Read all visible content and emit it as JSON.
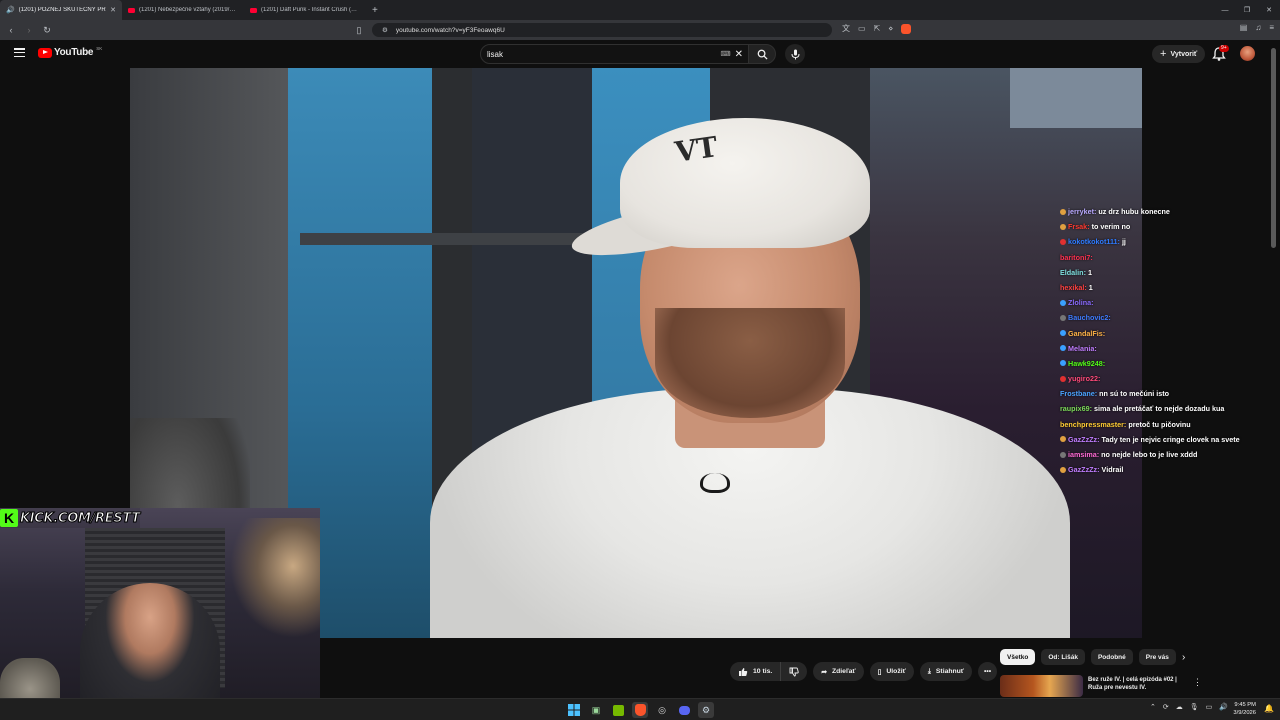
{
  "browser": {
    "tabs": [
      {
        "title": "(1201) POZNEJ SKUTEČNÝ PŘ",
        "active": true
      },
      {
        "title": "(1201) Nebezpečné vztahy (2019/2020",
        "active": false
      },
      {
        "title": "(1201) Daft Punk - Instant Crush (Offi",
        "active": false
      }
    ],
    "new_tab": "+",
    "url": "youtube.com/watch?v=yF3Feoawq6U"
  },
  "youtube": {
    "logo_text": "YouTube",
    "country_code": "SK",
    "search_query": "lisak",
    "create_label": "Vytvoriť",
    "notif_count": "9+"
  },
  "chat": [
    {
      "user": "jerryket",
      "text": "uz drz hubu konecne",
      "color": "#b9a9ff",
      "dot": "#e0a040"
    },
    {
      "user": "Frsak",
      "text": "to verim no",
      "color": "#ff3b30",
      "dot": "#e0a040"
    },
    {
      "user": "kokotkokot111",
      "text": "jj",
      "color": "#2e7bff",
      "dot": "#e03030"
    },
    {
      "user": "baritoni7",
      "text": "",
      "color": "#ff3050",
      "dot": null
    },
    {
      "user": "Eldalin",
      "text": "1",
      "color": "#7fe0e0",
      "dot": null
    },
    {
      "user": "hexikal",
      "text": "1",
      "color": "#ff4040",
      "dot": null
    },
    {
      "user": "Zlolina",
      "text": "",
      "color": "#8a6bff",
      "dot": "#3aa0ff"
    },
    {
      "user": "Bauchovic2",
      "text": "",
      "color": "#3f7cff",
      "dot": "#777777"
    },
    {
      "user": "GandalFis",
      "text": "",
      "color": "#ffb347",
      "dot": "#3aa0ff"
    },
    {
      "user": "Melania",
      "text": "",
      "color": "#c07dff",
      "dot": "#3aa0ff"
    },
    {
      "user": "Hawk9248",
      "text": "",
      "color": "#53fc18",
      "dot": "#3aa0ff"
    },
    {
      "user": "yugiro22",
      "text": "",
      "color": "#ff4a7a",
      "dot": "#e03030"
    },
    {
      "user": "Frostbane",
      "text": "nn sú to mečúni isto",
      "color": "#4aa3ff",
      "dot": null
    },
    {
      "user": "raupix69",
      "text": "sima ale pretáčať to nejde dozadu kua",
      "color": "#7ddb5a",
      "dot": null
    },
    {
      "user": "benchpressmaster",
      "text": "pretoč tu pičovinu",
      "color": "#ffcc33",
      "dot": null
    },
    {
      "user": "GazZzZz",
      "text": "Tady ten je nejvic cringe clovek na svete",
      "color": "#c07dff",
      "dot": "#e0a040"
    },
    {
      "user": "iamsima",
      "text": "no nejde lebo to je live xddd",
      "color": "#ff6ad5",
      "dot": "#777777"
    },
    {
      "user": "GazZzZz",
      "text": "Vidrail",
      "color": "#c07dff",
      "dot": "#e0a040"
    }
  ],
  "stream": {
    "kick_text": "KICK.COM/RESTT"
  },
  "actions": {
    "likes": "10 tis.",
    "share": "Zdieľať",
    "save": "Uložiť",
    "download": "Stiahnuť"
  },
  "chips": [
    "Všetko",
    "Od: Lišák",
    "Podobné",
    "Pre vás"
  ],
  "recommended": {
    "title": "Bez ruže IV. | celá epizóda #02 | Ruža pre nevestu IV."
  },
  "taskbar": {
    "time": "9:45 PM",
    "date": "3/9/2026"
  }
}
